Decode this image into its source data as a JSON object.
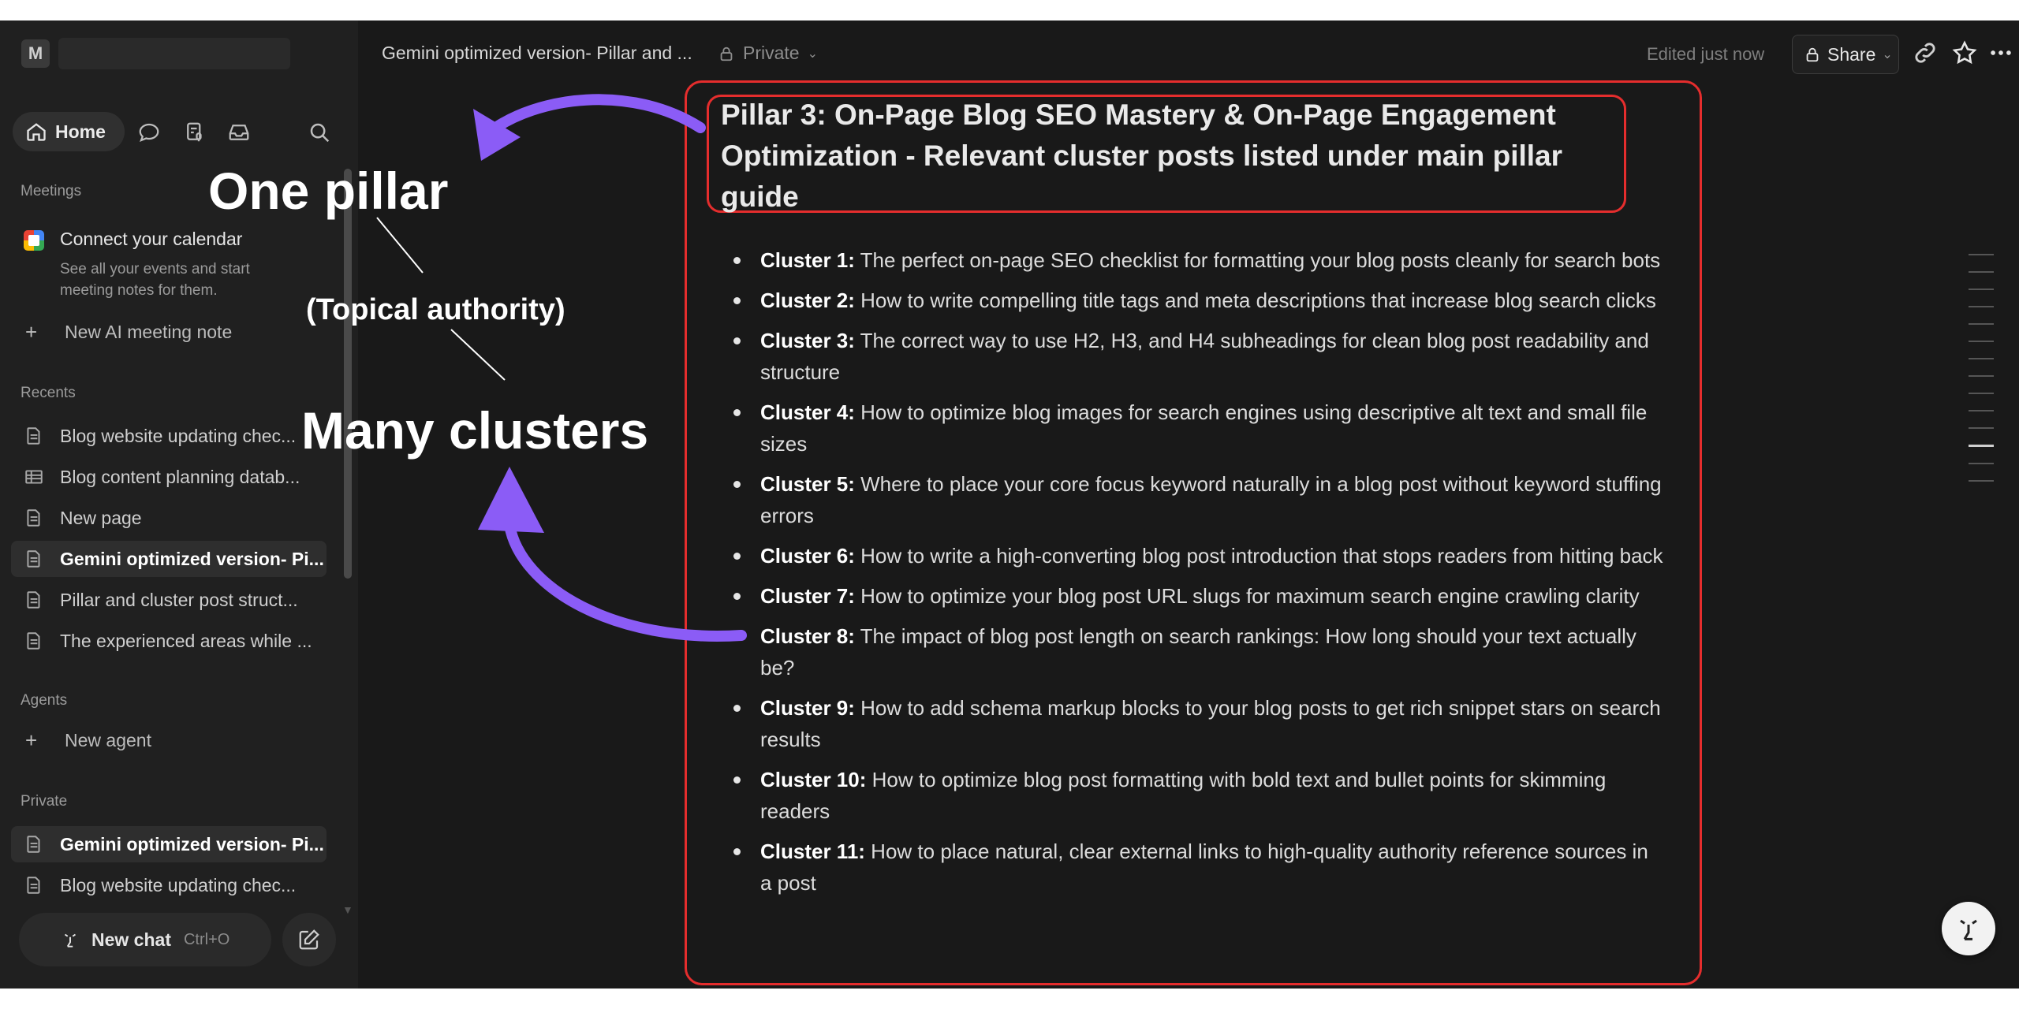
{
  "sidebar": {
    "workspace_initial": "M",
    "home_label": "Home",
    "meetings": {
      "heading": "Meetings",
      "calendar_title": "Connect your calendar",
      "calendar_desc": "See all your events and start meeting notes for them.",
      "new_ai_note": "New AI meeting note"
    },
    "recents": {
      "heading": "Recents",
      "items": [
        {
          "label": "Blog website updating chec...",
          "icon": "page-icon"
        },
        {
          "label": "Blog content planning datab...",
          "icon": "database-icon"
        },
        {
          "label": "New page",
          "icon": "page-icon"
        },
        {
          "label": "Gemini optimized version- Pi...",
          "icon": "page-icon"
        },
        {
          "label": "Pillar and cluster post struct...",
          "icon": "page-icon"
        },
        {
          "label": "The experienced areas while ...",
          "icon": "page-icon"
        }
      ]
    },
    "agents": {
      "heading": "Agents",
      "new_agent": "New agent"
    },
    "private": {
      "heading": "Private",
      "items": [
        {
          "label": "Gemini optimized version- Pi...",
          "icon": "page-icon"
        },
        {
          "label": "Blog website updating chec...",
          "icon": "page-icon"
        }
      ]
    },
    "new_chat": {
      "label": "New chat",
      "shortcut": "Ctrl+O"
    }
  },
  "topbar": {
    "doc_title": "Gemini optimized version- Pillar and ...",
    "privacy": "Private",
    "edited": "Edited just now",
    "share": "Share"
  },
  "page": {
    "heading": "Pillar 3: On-Page Blog SEO Mastery & On-Page Engagement Optimization - Relevant cluster posts listed under main pillar guide",
    "clusters": [
      {
        "label": "Cluster 1:",
        "text": " The perfect on-page SEO checklist for formatting your blog posts cleanly for search bots"
      },
      {
        "label": "Cluster 2:",
        "text": " How to write compelling title tags and meta descriptions that increase blog search clicks"
      },
      {
        "label": "Cluster 3:",
        "text": " The correct way to use H2, H3, and H4 subheadings for clean blog post readability and structure"
      },
      {
        "label": "Cluster 4:",
        "text": " How to optimize blog images for search engines using descriptive alt text and small file sizes"
      },
      {
        "label": "Cluster 5:",
        "text": " Where to place your core focus keyword naturally in a blog post without keyword stuffing errors"
      },
      {
        "label": "Cluster 6:",
        "text": " How to write a high-converting blog post introduction that stops readers from hitting back"
      },
      {
        "label": "Cluster 7:",
        "text": " How to optimize your blog post URL slugs for maximum search engine crawling clarity"
      },
      {
        "label": "Cluster 8:",
        "text": " The impact of blog post length on search rankings: How long should your text actually be?"
      },
      {
        "label": "Cluster 9:",
        "text": " How to add schema markup blocks to your blog posts to get rich snippet stars on search results"
      },
      {
        "label": "Cluster 10:",
        "text": " How to optimize blog post formatting with bold text and bullet points for skimming readers"
      },
      {
        "label": "Cluster 11:",
        "text": " How to place natural, clear external links to high-quality authority reference sources in a post"
      }
    ]
  },
  "annotations": {
    "one_pillar": "One pillar",
    "topical_authority": "(Topical authority)",
    "many_clusters": "Many clusters"
  },
  "colors": {
    "highlight_box": "#e52d2d",
    "arrow": "#8b5cf6"
  }
}
